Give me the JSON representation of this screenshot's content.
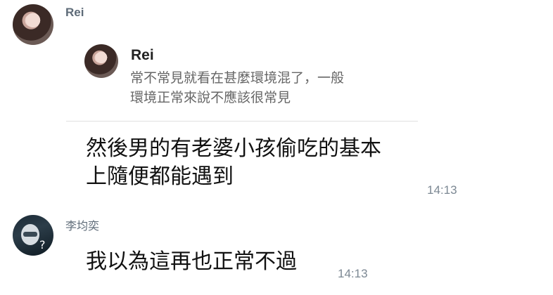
{
  "messages": [
    {
      "sender": "Rei",
      "reply_to": {
        "sender": "Rei",
        "text_line1": "常不常見就看在甚麼環境混了，一般",
        "text_line2": "環境正常來說不應該很常見"
      },
      "text_line1": "然後男的有老婆小孩偷吃的基本",
      "text_line2": "上隨便都能遇到",
      "time": "14:13"
    },
    {
      "sender": "李均奕",
      "text": "我以為這再也正常不過",
      "time": "14:13"
    }
  ],
  "icons": {
    "avatar_rei": "avatar-photo",
    "avatar_li": "avatar-photo"
  }
}
